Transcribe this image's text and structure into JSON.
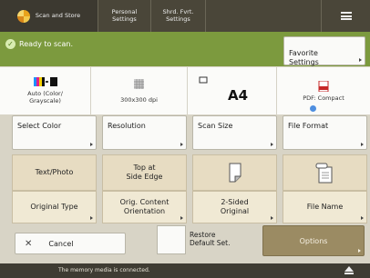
{
  "header": {
    "tabs": [
      {
        "label": "Scan and Store"
      },
      {
        "label": "Personal\nSettings"
      },
      {
        "label": "Shrd. Fvrt.\nSettings"
      }
    ],
    "logo_icon": "scan-app-icon",
    "menu_icon": "hamburger-menu-icon"
  },
  "status": {
    "message": "Ready to scan.",
    "icon": "ready-check-icon",
    "favorite_label": "Favorite\nSettings"
  },
  "summary": {
    "color": {
      "text": "Auto (Color/\nGrayscale)",
      "icon": "color-mode-icon"
    },
    "resolution": {
      "text": "300x300 dpi",
      "icon": "resolution-icon"
    },
    "scan_size": {
      "text": "A4",
      "icon": "paper-icon"
    },
    "file_format": {
      "text": "PDF: Compact",
      "icon": "pdf-icon"
    }
  },
  "settings_buttons": {
    "select_color": "Select Color",
    "resolution": "Resolution",
    "scan_size": "Scan Size",
    "file_format": "File Format"
  },
  "tiles": {
    "original_type": {
      "value": "Text/Photo",
      "label": "Original Type"
    },
    "orientation": {
      "value": "Top at\nSide Edge",
      "label": "Orig. Content\nOrientation"
    },
    "two_sided": {
      "label": "2-Sided\nOriginal",
      "icon": "two-sided-icon"
    },
    "file_name": {
      "label": "File Name",
      "icon": "file-name-icon"
    }
  },
  "actions": {
    "cancel": "Cancel",
    "restore": "Restore\nDefault Set.",
    "options": "Options"
  },
  "footer": {
    "message": "The memory media is connected.",
    "eject_icon": "eject-icon"
  },
  "colors": {
    "header_bg": "#4a4639",
    "status_bg": "#7c9a3e",
    "tile_bg": "#e7dcc2",
    "options_bg": "#9b8b63"
  }
}
